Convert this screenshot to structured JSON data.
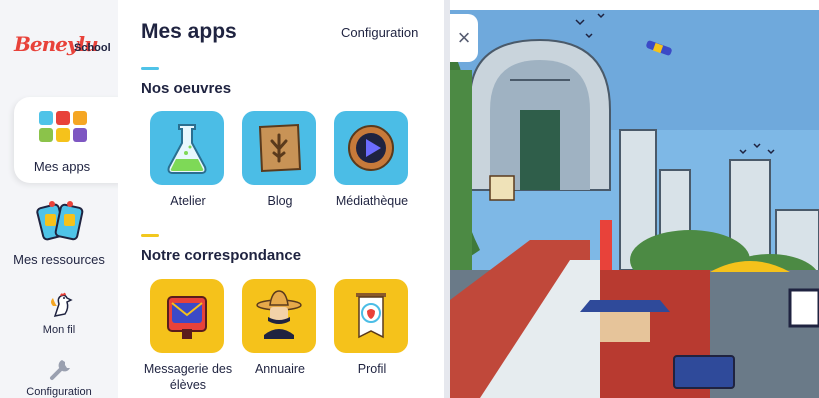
{
  "brand": {
    "logo_text": "Beneylu",
    "logo_sub": "School"
  },
  "nav": {
    "apps_label": "Mes apps",
    "resources_label": "Mes ressources",
    "feed_label": "Mon fil",
    "config_label": "Configuration"
  },
  "panel": {
    "title": "Mes apps",
    "config_link": "Configuration"
  },
  "sections": [
    {
      "title": "Nos oeuvres",
      "accent": "#4fc3e8",
      "apps": [
        {
          "name": "Atelier",
          "icon": "flask-icon"
        },
        {
          "name": "Blog",
          "icon": "parchment-icon"
        },
        {
          "name": "Médiathèque",
          "icon": "play-icon"
        }
      ]
    },
    {
      "title": "Notre correspondance",
      "accent": "#f2c81e",
      "apps": [
        {
          "name": "Messagerie des élèves",
          "icon": "mailbox-icon"
        },
        {
          "name": "Annuaire",
          "icon": "sombrero-character-icon"
        },
        {
          "name": "Profil",
          "icon": "profile-banner-icon"
        }
      ]
    }
  ],
  "colors": {
    "blue_tile": "#4bbde6",
    "yellow_tile": "#f5c21b",
    "text": "#1f2340",
    "logo_red": "#e8423a"
  },
  "close_icon": "×"
}
